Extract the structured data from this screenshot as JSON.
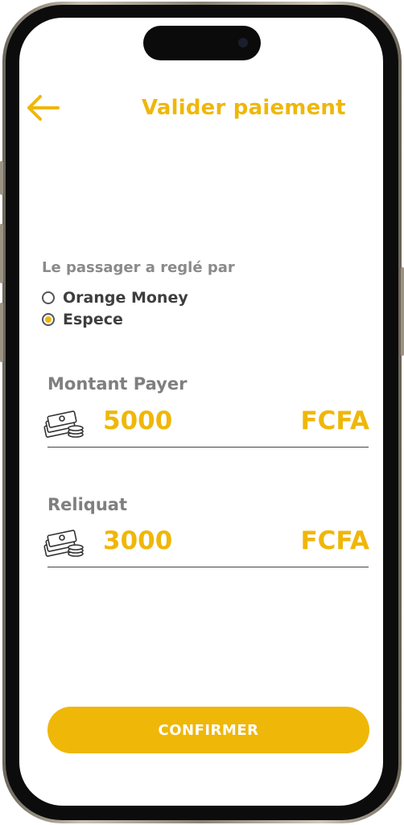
{
  "header": {
    "title": "Valider paiement",
    "back_icon": "arrow-left-icon"
  },
  "payment_method": {
    "label": "Le passager a reglé par",
    "options": [
      {
        "label": "Orange Money",
        "selected": false
      },
      {
        "label": "Espece",
        "selected": true
      }
    ]
  },
  "amount_paid": {
    "label": "Montant Payer",
    "value": "5000",
    "currency": "FCFA",
    "icon": "money-stack-icon"
  },
  "change": {
    "label": "Reliquat",
    "value": "3000",
    "currency": "FCFA",
    "icon": "money-stack-icon"
  },
  "actions": {
    "confirm_label": "CONFIRMER"
  },
  "colors": {
    "accent": "#efb708",
    "label_gray": "#7f7f7f",
    "text_dark": "#3e3e3e"
  }
}
